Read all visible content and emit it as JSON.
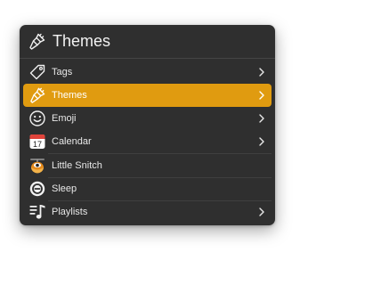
{
  "header": {
    "title": "Themes",
    "icon": "brush-icon"
  },
  "menu": {
    "selected_index": 1,
    "accent_color": "#e09b10",
    "items": [
      {
        "label": "Tags",
        "icon": "tag-icon",
        "has_submenu": true
      },
      {
        "label": "Themes",
        "icon": "brush-icon",
        "has_submenu": true
      },
      {
        "label": "Emoji",
        "icon": "smiley-icon",
        "has_submenu": true
      },
      {
        "label": "Calendar",
        "icon": "calendar-icon",
        "icon_text": "17",
        "has_submenu": true
      },
      {
        "label": "Little Snitch",
        "icon": "little-snitch-icon",
        "has_submenu": false
      },
      {
        "label": "Sleep",
        "icon": "sleep-icon",
        "has_submenu": false
      },
      {
        "label": "Playlists",
        "icon": "playlist-icon",
        "has_submenu": true
      }
    ]
  }
}
